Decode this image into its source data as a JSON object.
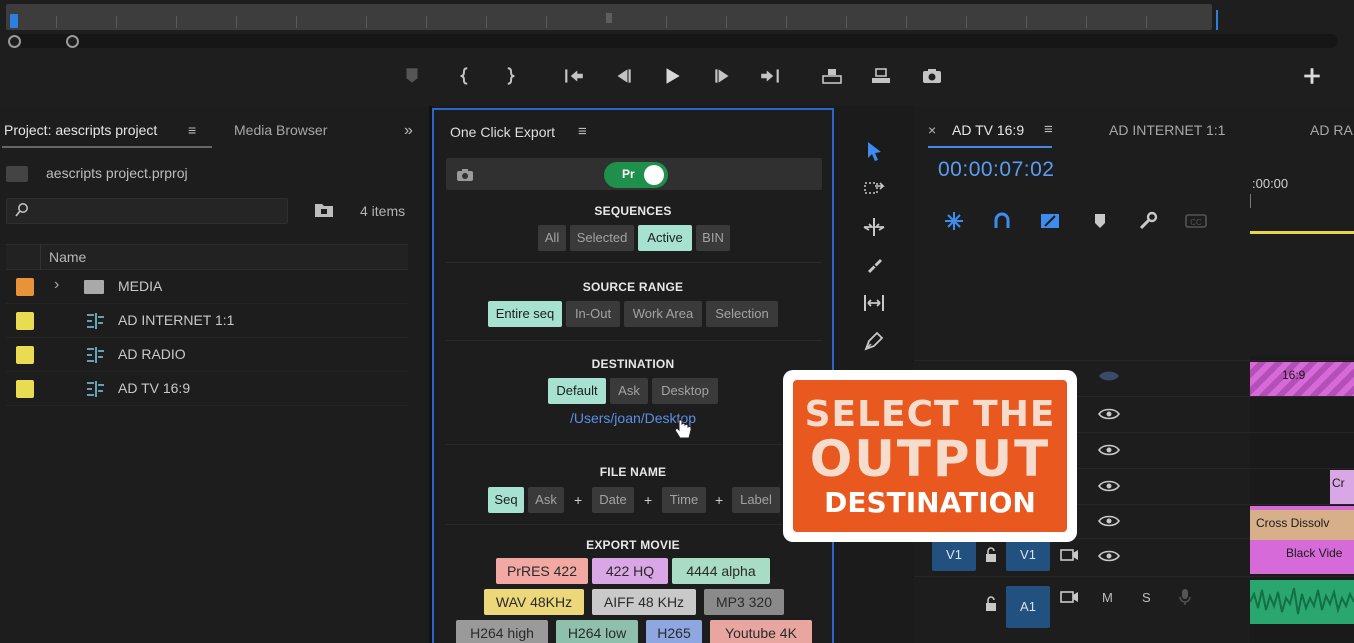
{
  "project_panel": {
    "tab_active": "Project: aescripts project",
    "tab_other": "Media Browser",
    "file_name": "aescripts project.prproj",
    "items_count": "4 items",
    "column_name": "Name",
    "items": [
      {
        "label": "MEDIA",
        "color": "#e8923a",
        "kind": "folder"
      },
      {
        "label": "AD INTERNET 1:1",
        "color": "#e9dc52",
        "kind": "sequence"
      },
      {
        "label": "AD RADIO",
        "color": "#e9dc52",
        "kind": "sequence"
      },
      {
        "label": "AD TV 16:9",
        "color": "#e9dc52",
        "kind": "sequence"
      }
    ]
  },
  "one_click_export": {
    "title": "One Click Export",
    "toggle_label": "Pr",
    "sequences": {
      "title": "SEQUENCES",
      "options": [
        "All",
        "Selected",
        "Active",
        "BIN"
      ],
      "active": "Active"
    },
    "source_range": {
      "title": "SOURCE RANGE",
      "options": [
        "Entire seq",
        "In-Out",
        "Work Area",
        "Selection"
      ],
      "active": "Entire seq"
    },
    "destination": {
      "title": "DESTINATION",
      "options": [
        "Default",
        "Ask",
        "Desktop"
      ],
      "active": "Default",
      "path": "/Users/joan/Desktop"
    },
    "file_name": {
      "title": "FILE NAME",
      "options": [
        "Seq",
        "Ask",
        "Date",
        "Time",
        "Label"
      ],
      "active": "Seq",
      "separator": "+"
    },
    "export_movie": {
      "title": "EXPORT MOVIE",
      "formats": [
        {
          "label": "PrRES 422",
          "color": "#f2a9a4"
        },
        {
          "label": "422 HQ",
          "color": "#d9a6e6"
        },
        {
          "label": "4444 alpha",
          "color": "#a8dcc4"
        },
        {
          "label": "WAV 48KHz",
          "color": "#ecd77a"
        },
        {
          "label": "AIFF 48 KHz",
          "color": "#c9c9c9"
        },
        {
          "label": "MP3 320",
          "color": "#8a8a8a"
        },
        {
          "label": "H264 high",
          "color": "#9a9a9a"
        },
        {
          "label": "H264 low",
          "color": "#8fc0ad"
        },
        {
          "label": "H265",
          "color": "#8fa7e0"
        },
        {
          "label": "Youtube 4K",
          "color": "#e9a6a0"
        }
      ]
    }
  },
  "timeline_panel": {
    "tab_active": "AD TV 16:9",
    "tab_2": "AD INTERNET 1:1",
    "tab_3": "AD RA",
    "timecode": "00:00:07:02",
    "ruler_time": ":00:00",
    "clips": [
      {
        "label": "16:9",
        "color": "#d76ad9"
      },
      {
        "label": "Cr",
        "color": "#d9a6e6"
      },
      {
        "label": "Cross Dissolv",
        "color": "#d7b08a"
      },
      {
        "label": "Black Vide",
        "color": "#d76ad9"
      }
    ],
    "tracks": {
      "v1_source": "V1",
      "v1_target": "V1",
      "a1": "A1",
      "mute": "M",
      "solo": "S"
    }
  },
  "overlay": {
    "line1": "SELECT THE",
    "line2": "OUTPUT",
    "line3": "DESTINATION"
  },
  "colors": {
    "accent_blue": "#2f7fe0",
    "toggle_green": "#1f8f4c",
    "chip_active": "#a6e2cf",
    "overlay_orange": "#e9581e",
    "timecode_blue": "#5a9cf0"
  },
  "icons": {
    "transport": [
      "add-marker-icon",
      "mark-in-icon",
      "mark-out-icon",
      "go-to-in-icon",
      "step-back-icon",
      "play-icon",
      "step-forward-icon",
      "go-to-out-icon",
      "lift-icon",
      "extract-icon",
      "export-frame-icon",
      "add-button-icon"
    ],
    "tools": [
      "selection-tool-icon",
      "track-select-tool-icon",
      "ripple-edit-tool-icon",
      "razor-tool-icon",
      "slip-tool-icon",
      "pen-tool-icon"
    ],
    "timeline": [
      "snap-icon",
      "linked-selection-icon",
      "nest-icon",
      "add-marker-icon",
      "wrench-icon",
      "captions-icon"
    ]
  }
}
